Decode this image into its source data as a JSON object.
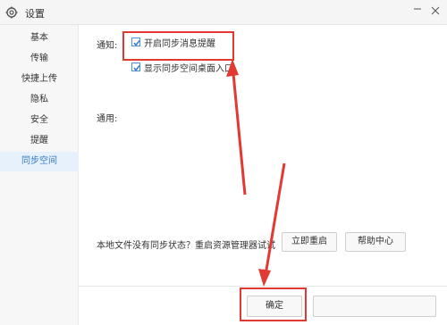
{
  "window": {
    "title": "设置"
  },
  "sidebar": {
    "items": [
      {
        "label": "基本"
      },
      {
        "label": "传输"
      },
      {
        "label": "快捷上传"
      },
      {
        "label": "隐私"
      },
      {
        "label": "安全"
      },
      {
        "label": "提醒"
      },
      {
        "label": "同步空间"
      }
    ],
    "active_index": 6
  },
  "notify": {
    "label": "通知:",
    "option1": {
      "label": "开启同步消息提醒",
      "checked": true
    },
    "option2": {
      "label": "显示同步空间桌面入口",
      "checked": true
    }
  },
  "general": {
    "label": "通用:"
  },
  "status": {
    "question": "本地文件没有同步状态？重启资源管理器试试",
    "restart_label": "立即重启",
    "help_label": "帮助中心"
  },
  "footer": {
    "ok_label": "确定",
    "cancel_label": ""
  },
  "colors": {
    "accent": "#3579c6",
    "annotation_red": "#e23a33"
  },
  "icons": {
    "app": "gear-icon",
    "minimize": "minimize-icon",
    "close": "close-icon"
  }
}
